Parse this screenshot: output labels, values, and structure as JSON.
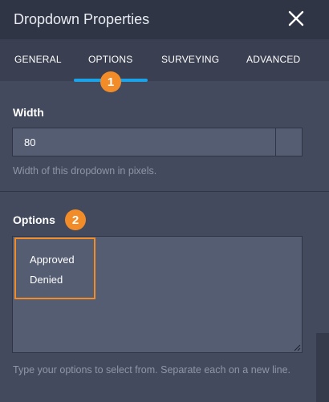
{
  "header": {
    "title": "Dropdown Properties",
    "close_icon": "close-icon"
  },
  "tabs": [
    {
      "label": "GENERAL"
    },
    {
      "label": "OPTIONS"
    },
    {
      "label": "SURVEYING"
    },
    {
      "label": "ADVANCED"
    }
  ],
  "active_tab": "OPTIONS",
  "badges": {
    "one": "1",
    "two": "2"
  },
  "width_field": {
    "label": "Width",
    "value": "80",
    "helper": "Width of this dropdown in pixels."
  },
  "options_field": {
    "label": "Options",
    "items": [
      "Approved",
      "Denied"
    ],
    "helper": "Type your options to select from. Separate each on a new line."
  },
  "colors": {
    "accent": "#1aa3e8",
    "badge": "#f28c28",
    "panel": "#434a5d",
    "header": "#2f3545"
  }
}
